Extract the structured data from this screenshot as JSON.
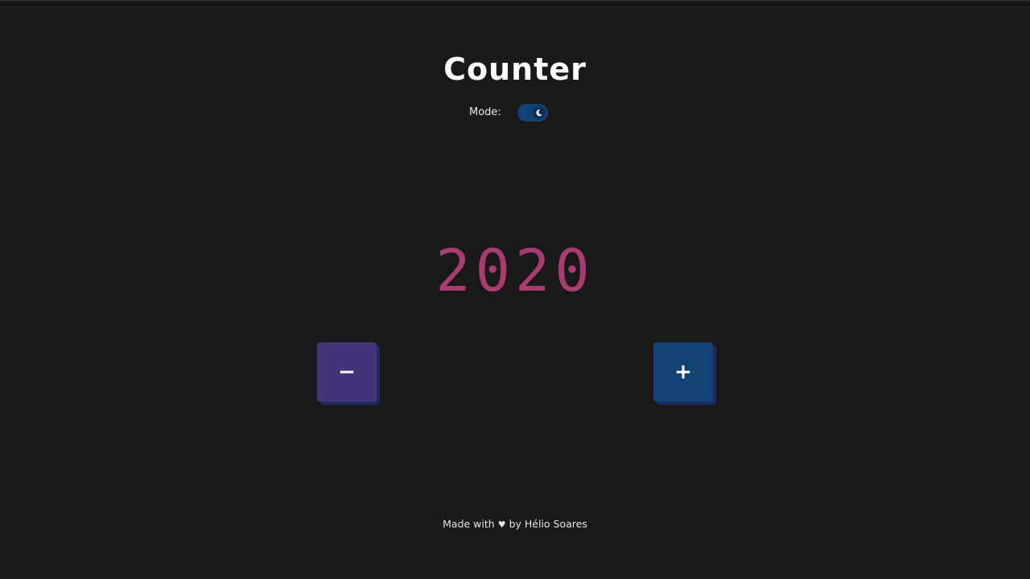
{
  "title": "Counter",
  "mode": {
    "label": "Mode:",
    "icon": "moon-icon",
    "state": "dark"
  },
  "counter": {
    "value": "2020",
    "color": "#a83b70"
  },
  "buttons": {
    "decrement_label": "−",
    "increment_label": "+",
    "decrement_color": "#44357a",
    "increment_color": "#134274"
  },
  "footer": {
    "prefix": "Made with",
    "heart": "♥",
    "suffix": "by Hélio Soares"
  },
  "colors": {
    "background": "#191919",
    "toggle_track": "#134274"
  }
}
